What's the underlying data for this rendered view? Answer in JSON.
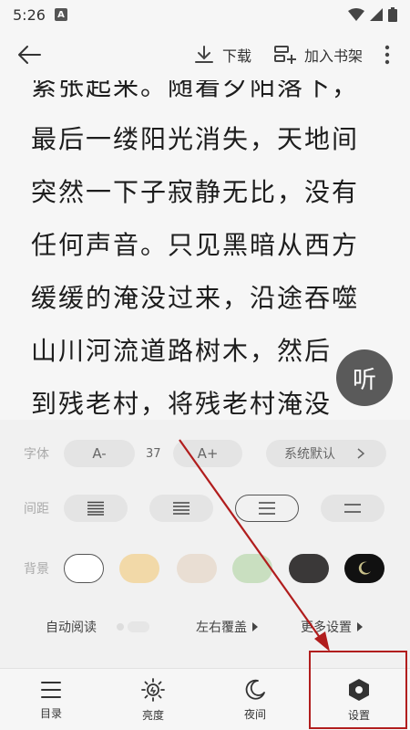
{
  "status_bar": {
    "time": "5:26",
    "notification_icon_label": "A"
  },
  "app_bar": {
    "download_label": "下载",
    "add_shelf_label": "加入书架"
  },
  "reader": {
    "lines": [
      "紧张起来。随着夕阳落下，",
      "最后一缕阳光消失，天地间",
      "突然一下子寂静无比，没有",
      "任何声音。只见黑暗从西方",
      "缓缓的淹没过来，沿途吞噬",
      "山川河流道路树木，然后",
      "到残老村，将残老村淹没"
    ],
    "listen_label": "听"
  },
  "settings_panel": {
    "font": {
      "label": "字体",
      "decrease_label": "A-",
      "size_value": "37",
      "increase_label": "A+",
      "font_family_label": "系统默认"
    },
    "spacing": {
      "label": "间距"
    },
    "background": {
      "label": "背景",
      "colors": [
        "#ffffff",
        "#f2d9a8",
        "#e9ded3",
        "#c9dfc0",
        "#3a3838",
        "#111111"
      ]
    },
    "options": {
      "auto_read_label": "自动阅读",
      "page_turn_label": "左右覆盖",
      "more_settings_label": "更多设置"
    }
  },
  "bottom_nav": {
    "toc_label": "目录",
    "brightness_label": "亮度",
    "night_label": "夜间",
    "settings_label": "设置"
  },
  "annotation": {
    "accent_color": "#b11d1d"
  }
}
